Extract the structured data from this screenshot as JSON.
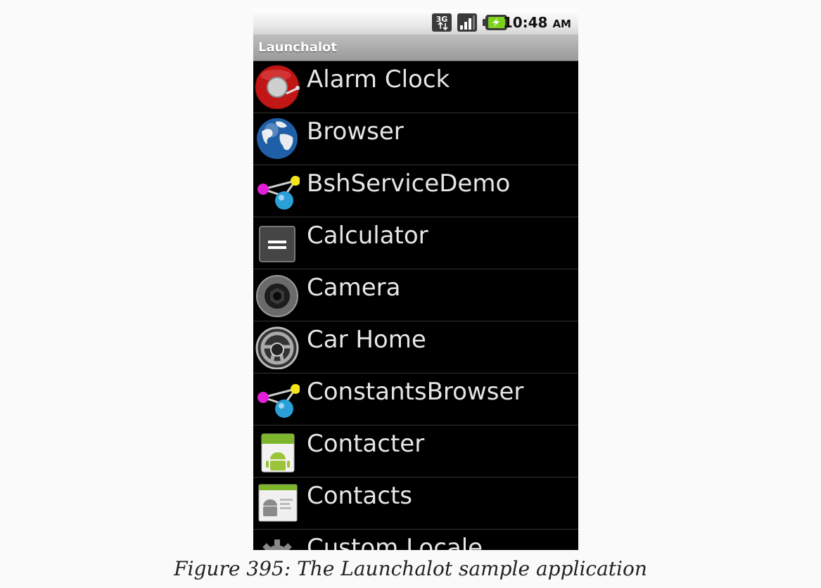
{
  "status_bar": {
    "network_label": "3G",
    "time": "10:48",
    "ampm": "AM",
    "icons": [
      "3g-data-icon",
      "signal-bars-icon",
      "battery-charging-icon"
    ]
  },
  "app": {
    "title": "Launchalot"
  },
  "apps": [
    {
      "label": "Alarm Clock",
      "icon": "alarm-clock-icon"
    },
    {
      "label": "Browser",
      "icon": "globe-icon"
    },
    {
      "label": "BshServiceDemo",
      "icon": "molecule-icon"
    },
    {
      "label": "Calculator",
      "icon": "calculator-icon"
    },
    {
      "label": "Camera",
      "icon": "camera-lens-icon"
    },
    {
      "label": "Car Home",
      "icon": "steering-wheel-icon"
    },
    {
      "label": "ConstantsBrowser",
      "icon": "molecule-icon"
    },
    {
      "label": "Contacter",
      "icon": "android-robot-icon"
    },
    {
      "label": "Contacts",
      "icon": "contacts-card-icon"
    },
    {
      "label": "Custom Locale",
      "icon": "gear-icon"
    }
  ],
  "caption": "Figure 395: The Launchalot sample application"
}
